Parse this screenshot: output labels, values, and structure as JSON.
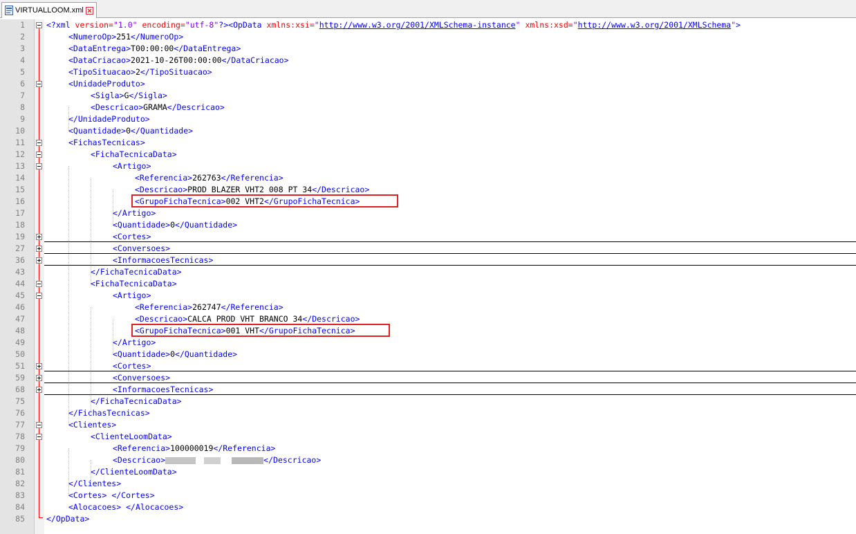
{
  "tab": {
    "filename": "VIRTUALLOOM.xml",
    "file_icon": "xml-file-icon",
    "close_icon": "close-icon",
    "close_color": "#d03030"
  },
  "colors": {
    "tag": "#0000ff",
    "attr": "#ff0000",
    "attr_value": "#8000ff",
    "text": "#000000",
    "line_number": "#808080",
    "highlight": "#e02020"
  },
  "lines": [
    {
      "n": "1"
    },
    {
      "n": "2"
    },
    {
      "n": "3"
    },
    {
      "n": "4"
    },
    {
      "n": "5"
    },
    {
      "n": "6"
    },
    {
      "n": "7"
    },
    {
      "n": "8"
    },
    {
      "n": "9"
    },
    {
      "n": "10"
    },
    {
      "n": "11"
    },
    {
      "n": "12"
    },
    {
      "n": "13"
    },
    {
      "n": "14"
    },
    {
      "n": "15"
    },
    {
      "n": "16"
    },
    {
      "n": "17"
    },
    {
      "n": "18"
    },
    {
      "n": "19"
    },
    {
      "n": "27"
    },
    {
      "n": "36"
    },
    {
      "n": "43"
    },
    {
      "n": "44"
    },
    {
      "n": "45"
    },
    {
      "n": "46"
    },
    {
      "n": "47"
    },
    {
      "n": "48"
    },
    {
      "n": "49"
    },
    {
      "n": "50"
    },
    {
      "n": "51"
    },
    {
      "n": "59"
    },
    {
      "n": "68"
    },
    {
      "n": "75"
    },
    {
      "n": "76"
    },
    {
      "n": "77"
    },
    {
      "n": "78"
    },
    {
      "n": "79"
    },
    {
      "n": "80"
    },
    {
      "n": "81"
    },
    {
      "n": "82"
    },
    {
      "n": "83"
    },
    {
      "n": "84"
    },
    {
      "n": "85"
    }
  ],
  "code": {
    "l1": {
      "xml_open": "<?xml",
      "version_attr": " version=",
      "version_val": "\"1.0\"",
      "encoding_attr": " encoding=",
      "encoding_val": "\"utf-8\"",
      "xml_close": "?>",
      "opdata_open": "<OpData",
      "xsi_attr": " xmlns:xsi=",
      "xsi_val": "\"http://www.w3.org/2001/XMLSchema-instance\"",
      "xsd_attr": " xmlns:xsd=",
      "xsd_val": "\"http://www.w3.org/2001/XMLSchema\"",
      "gt": ">"
    },
    "numero_op": {
      "open": "<NumeroOp>",
      "value": "251",
      "close": "</NumeroOp>"
    },
    "data_entrega": {
      "open": "<DataEntrega>",
      "value": "T00:00:00",
      "close": "</DataEntrega>"
    },
    "data_criacao": {
      "open": "<DataCriacao>",
      "value": "2021-10-26T00:00:00",
      "close": "</DataCriacao>"
    },
    "tipo_situacao": {
      "open": "<TipoSituacao>",
      "value": "2",
      "close": "</TipoSituacao>"
    },
    "unidade_produto_open": "<UnidadeProduto>",
    "sigla": {
      "open": "<Sigla>",
      "value": "G",
      "close": "</Sigla>"
    },
    "descricao_unidade": {
      "open": "<Descricao>",
      "value": "GRAMA",
      "close": "</Descricao>"
    },
    "unidade_produto_close": "</UnidadeProduto>",
    "quantidade_root": {
      "open": "<Quantidade>",
      "value": "0",
      "close": "</Quantidade>"
    },
    "fichas_open": "<FichasTecnicas>",
    "ficha_open": "<FichaTecnicaData>",
    "artigo_open": "<Artigo>",
    "ficha1": {
      "referencia": {
        "open": "<Referencia>",
        "value": "262763",
        "close": "</Referencia>"
      },
      "descricao": {
        "open": "<Descricao>",
        "value": "PROD BLAZER VHT2 008 PT 34",
        "close": "</Descricao>"
      },
      "grupo": {
        "open": "<GrupoFichaTecnica>",
        "value": "002 VHT2",
        "close": "</GrupoFichaTecnica>"
      }
    },
    "ficha2": {
      "referencia": {
        "open": "<Referencia>",
        "value": "262747",
        "close": "</Referencia>"
      },
      "descricao": {
        "open": "<Descricao>",
        "value": "CALCA PROD VHT BRANCO 34",
        "close": "</Descricao>"
      },
      "grupo": {
        "open": "<GrupoFichaTecnica>",
        "value": "001 VHT",
        "close": "</GrupoFichaTecnica>"
      }
    },
    "artigo_close": "</Artigo>",
    "quantidade_ficha": {
      "open": "<Quantidade>",
      "value": "0",
      "close": "</Quantidade>"
    },
    "cortes_open": "<Cortes>",
    "conversoes_open": "<Conversoes>",
    "informacoes_open": "<InformacoesTecnicas>",
    "ficha_close": "</FichaTecnicaData>",
    "fichas_close": "</FichasTecnicas>",
    "clientes_open": "<Clientes>",
    "cliente_open": "<ClienteLoomData>",
    "cliente_referencia": {
      "open": "<Referencia>",
      "value": "100000019",
      "close": "</Referencia>"
    },
    "cliente_descricao": {
      "open": "<Descricao>",
      "close": "</Descricao>"
    },
    "cliente_close": "</ClienteLoomData>",
    "clientes_close": "</Clientes>",
    "cortes_empty": {
      "open": "<Cortes>",
      "sep": " ",
      "close": "</Cortes>"
    },
    "alocacoes_empty": {
      "open": "<Alocacoes>",
      "sep": " ",
      "close": "</Alocacoes>"
    },
    "opdata_close": "</OpData>"
  }
}
